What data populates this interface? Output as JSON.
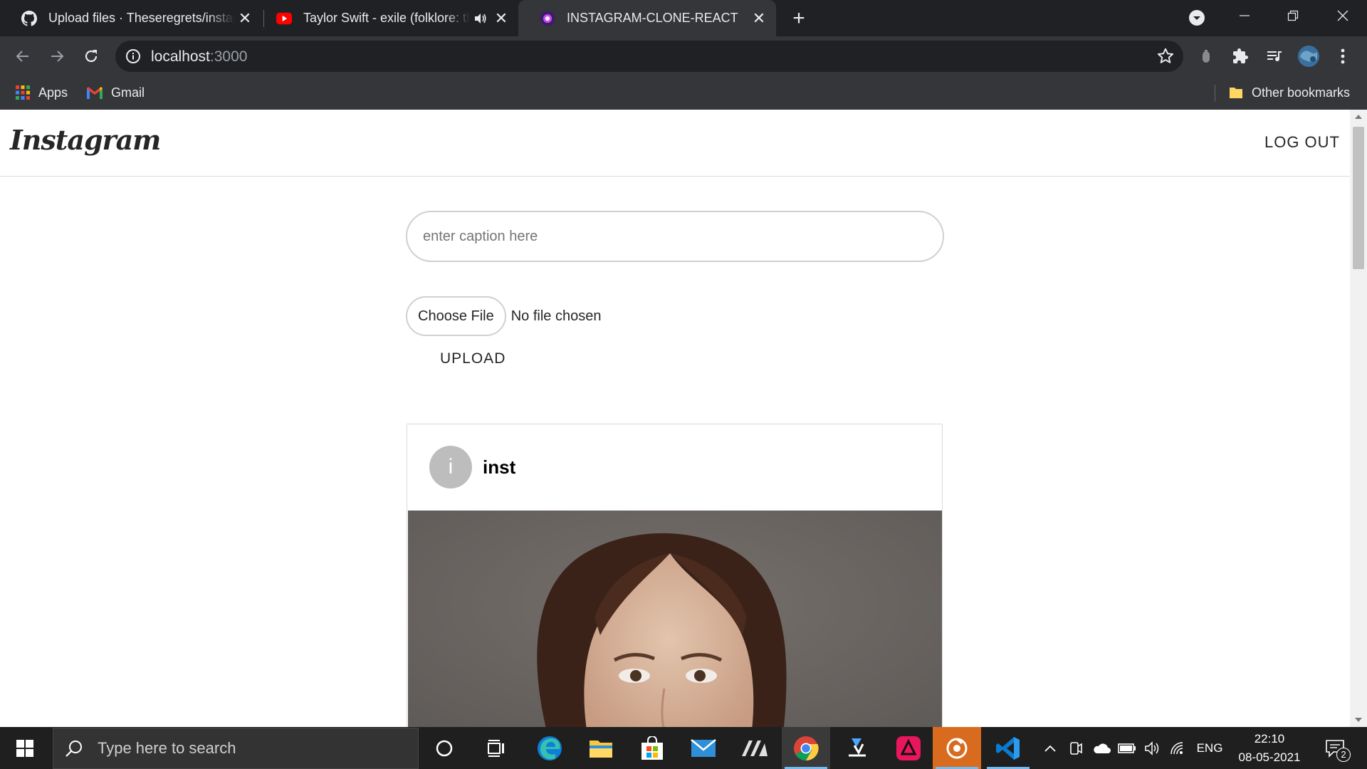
{
  "browser": {
    "tabs": [
      {
        "title": "Upload files · Theseregrets/instagram",
        "icon": "github-icon",
        "active": false
      },
      {
        "title": "Taylor Swift - exile (folklore: the long pond studio sessions)",
        "icon": "youtube-icon",
        "active": false,
        "audio": true
      },
      {
        "title": "INSTAGRAM-CLONE-REACT",
        "icon": "react-icon",
        "active": true
      }
    ],
    "url_host": "localhost",
    "url_port": ":3000",
    "bookmarks": [
      {
        "label": "Apps",
        "icon": "apps-grid-icon"
      },
      {
        "label": "Gmail",
        "icon": "gmail-icon"
      }
    ],
    "other_bookmarks": "Other bookmarks"
  },
  "app": {
    "logo": "Instagram",
    "logout_label": "LOG OUT",
    "caption_placeholder": "enter caption here",
    "caption_value": "",
    "choose_file_label": "Choose File",
    "no_file_label": "No file chosen",
    "upload_label": "UPLOAD",
    "post": {
      "avatar_letter": "i",
      "username": "inst"
    }
  },
  "taskbar": {
    "search_placeholder": "Type here to search",
    "apps": [
      "cortana-icon",
      "task-view-icon",
      "edge-icon",
      "file-explorer-icon",
      "store-icon",
      "mail-icon",
      "app-icon",
      "chrome-icon",
      "app-icon",
      "app-icon",
      "app-icon",
      "vscode-icon"
    ],
    "language": "ENG",
    "time": "22:10",
    "date": "08-05-2021",
    "notification_count": "2"
  },
  "colors": {
    "titlebar": "#202124",
    "toolbar": "#35363a",
    "page_bg": "#ffffff",
    "taskbar": "#1f1f1f"
  }
}
